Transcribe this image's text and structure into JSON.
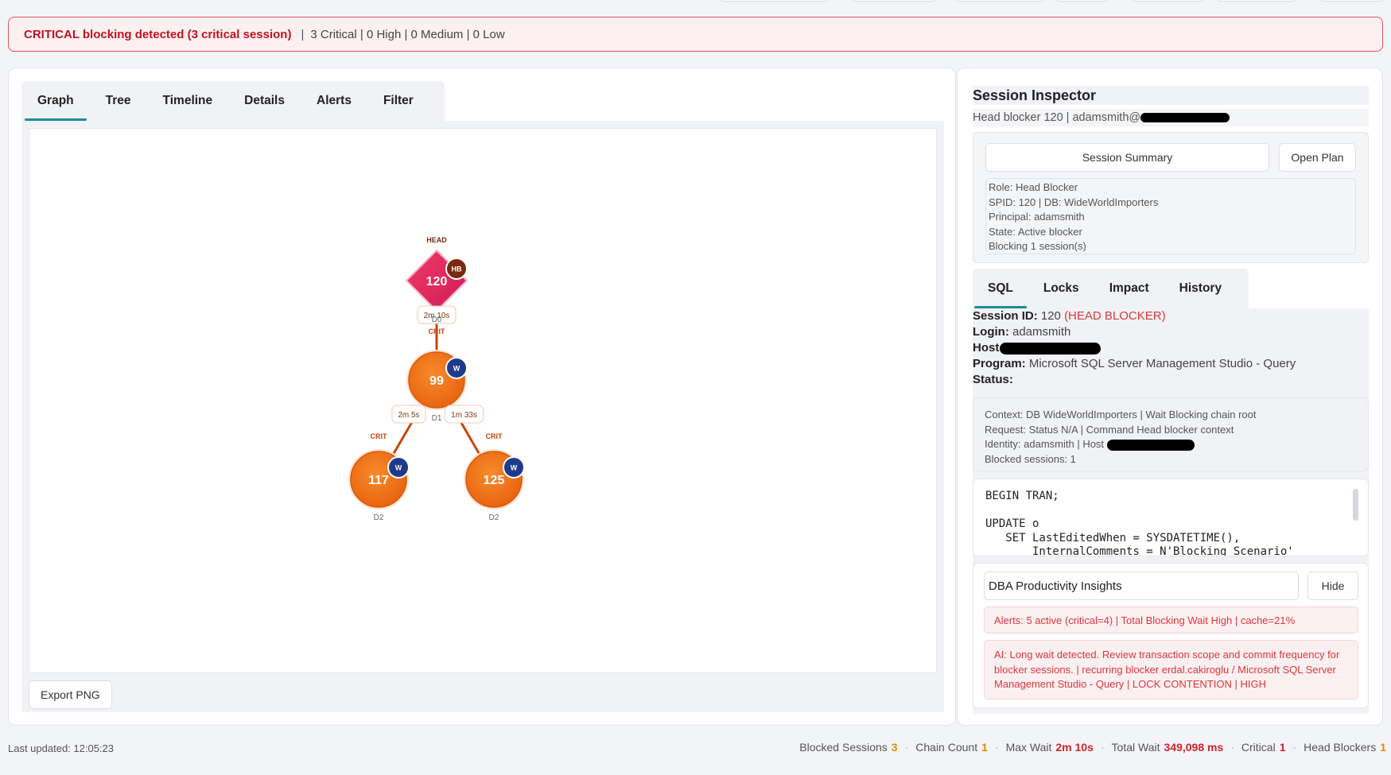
{
  "banner": {
    "critical_text": "CRITICAL blocking detected (3 critical session)",
    "separator": "|",
    "counts": "3 Critical | 0 High | 0 Medium | 0 Low"
  },
  "tabs": [
    {
      "label": "Graph",
      "active": true
    },
    {
      "label": "Tree"
    },
    {
      "label": "Timeline"
    },
    {
      "label": "Details"
    },
    {
      "label": "Alerts"
    },
    {
      "label": "Filter"
    }
  ],
  "graph": {
    "head_label": "HEAD",
    "nodes": [
      {
        "id": "120",
        "badge": "HB",
        "depth": "D0",
        "shape": "diamond"
      },
      {
        "id": "99",
        "badge": "W",
        "depth": "D1",
        "shape": "circle"
      },
      {
        "id": "117",
        "badge": "W",
        "depth": "D2",
        "shape": "circle"
      },
      {
        "id": "125",
        "badge": "W",
        "depth": "D2",
        "shape": "circle"
      }
    ],
    "edges": [
      {
        "from": "120",
        "to": "99",
        "wait": "2m 10s",
        "severity": "CRIT"
      },
      {
        "from": "99",
        "to": "117",
        "wait": "2m 5s",
        "severity": "CRIT"
      },
      {
        "from": "99",
        "to": "125",
        "wait": "1m 33s",
        "severity": "CRIT"
      }
    ],
    "colors": {
      "head": "#e0245e",
      "waiter": "#f07418",
      "badge_head": "#7a2a10",
      "badge_waiter": "#1f3a8a",
      "edge": "#c8460f"
    }
  },
  "export_label": "Export PNG",
  "inspector": {
    "title": "Session Inspector",
    "subtitle": "Head blocker 120 | adamsmith@",
    "summary_button": "Session Summary",
    "plan_button": "Open Plan",
    "summary_lines": [
      "Role: Head Blocker",
      "SPID: 120 | DB: WideWorldImporters",
      "Principal: adamsmith",
      "State: Active blocker",
      "Blocking 1 session(s)"
    ],
    "subtabs": [
      {
        "label": "SQL",
        "active": true
      },
      {
        "label": "Locks"
      },
      {
        "label": "Impact"
      },
      {
        "label": "History"
      }
    ],
    "fields": {
      "session_id_label": "Session ID:",
      "session_id_value": "120",
      "session_id_flag": "(HEAD BLOCKER)",
      "login_label": "Login:",
      "login_value": "adamsmith",
      "host_label": "Host:",
      "program_label": "Program:",
      "program_value": "Microsoft SQL Server Management Studio - Query",
      "status_label": "Status:"
    },
    "context_lines": [
      "Context: DB WideWorldImporters | Wait Blocking chain root",
      "Request: Status N/A | Command Head blocker context",
      "Identity: adamsmith | Host",
      "Blocked sessions: 1"
    ],
    "sql_code": "BEGIN TRAN;\n\nUPDATE o\n   SET LastEditedWhen = SYSDATETIME(),\n       InternalComments = N'Blocking Scenario'",
    "insights": {
      "title": "DBA Productivity Insights",
      "hide_button": "Hide",
      "alerts_line": "Alerts: 5 active (critical=4) | Total Blocking Wait High | cache=21%",
      "ai_line": "AI: Long wait detected. Review transaction scope and commit frequency for blocker sessions. | recurring blocker erdal.cakiroglu / Microsoft SQL Server Management Studio - Query | LOCK CONTENTION | HIGH"
    }
  },
  "footer": {
    "last_updated": "Last updated: 12:05:23",
    "stats": [
      {
        "label": "Blocked Sessions",
        "value": "3",
        "tone": "orange"
      },
      {
        "label": "Chain Count",
        "value": "1",
        "tone": "orange"
      },
      {
        "label": "Max Wait",
        "value": "2m 10s",
        "tone": "red"
      },
      {
        "label": "Total Wait",
        "value": "349,098 ms",
        "tone": "red"
      },
      {
        "label": "Critical",
        "value": "1",
        "tone": "red"
      },
      {
        "label": "Head Blockers",
        "value": "1",
        "tone": "orange"
      }
    ]
  }
}
